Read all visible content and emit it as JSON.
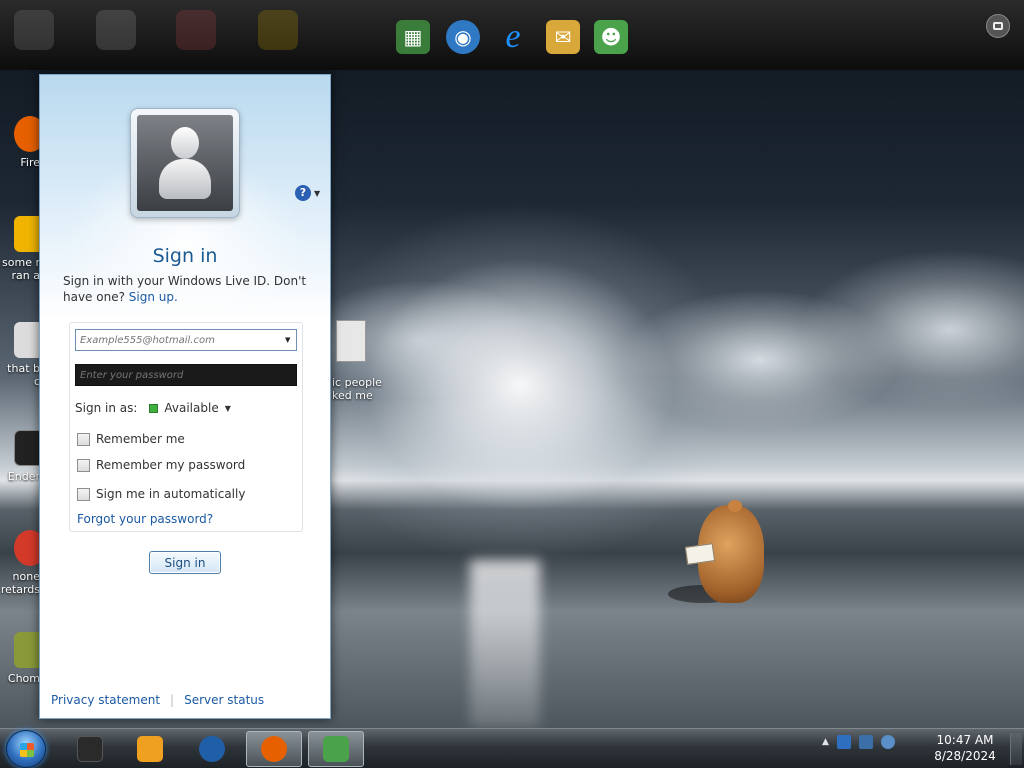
{
  "desktop": {
    "left_icons": [
      {
        "label_line1": "Fire",
        "label_line2": "",
        "color": "#e66000",
        "name": "firefox-desktop-icon"
      },
      {
        "label_line1": "some r",
        "label_line2": "ran a",
        "color": "#f0b400",
        "name": "d-desktop-icon"
      },
      {
        "label_line1": "that b",
        "label_line2": "c",
        "color": "#dcdcdc",
        "name": "briefcase-desktop-icon"
      },
      {
        "label_line1": "Ender",
        "label_line2": "",
        "color": "#222222",
        "name": "ender-desktop-icon"
      },
      {
        "label_line1": "none",
        "label_line2": "retards",
        "color": "#d33a2a",
        "name": "none-desktop-icon"
      },
      {
        "label_line1": "Chom",
        "label_line2": "",
        "color": "#8a9a3a",
        "name": "chom-desktop-icon"
      }
    ],
    "people_icon": {
      "line1": "ic people",
      "line2": "ked me"
    }
  },
  "top_dock": {
    "items": [
      {
        "name": "minecraft-icon",
        "glyph": "▦",
        "color": "#3a7d3a"
      },
      {
        "name": "globe-download-icon",
        "glyph": "◉",
        "color": "#2f78c4"
      },
      {
        "name": "internet-explorer-icon",
        "glyph": "e",
        "color": "#1e90ff"
      },
      {
        "name": "mail-icon",
        "glyph": "✉",
        "color": "#d8a93a"
      },
      {
        "name": "messenger-buddy-icon",
        "glyph": "☻",
        "color": "#4aa34a"
      }
    ]
  },
  "messenger": {
    "help_icon_glyph": "?",
    "title": "Sign in",
    "description": "Sign in with your Windows Live ID. Don't have one?",
    "signup_link": "Sign up.",
    "email_placeholder": "Example555@hotmail.com",
    "password_placeholder": "Enter your password",
    "status_label": "Sign in as:",
    "status_value": "Available",
    "status_color": "#3fb03f",
    "remember_me": "Remember me",
    "remember_password": "Remember my password",
    "sign_in_auto": "Sign me in automatically",
    "forgot_password": "Forgot your password?",
    "sign_in_button": "Sign in",
    "privacy_statement": "Privacy statement",
    "server_status": "Server status"
  },
  "taskbar": {
    "pinned": [
      {
        "name": "task-app-black",
        "color": "#2a2a2a"
      },
      {
        "name": "task-media-player",
        "color": "#f0a020"
      },
      {
        "name": "task-network-globe",
        "color": "#1f5fa8"
      },
      {
        "name": "task-firefox",
        "color": "#e66000"
      },
      {
        "name": "task-messenger",
        "color": "#4aa34a"
      }
    ],
    "tray": [
      {
        "name": "tray-up-arrow-icon",
        "color": "#cfd4d8"
      },
      {
        "name": "tray-device-icon",
        "color": "#2f6fbf"
      },
      {
        "name": "tray-monitor-icon",
        "color": "#3a6fa8"
      },
      {
        "name": "tray-network-icon",
        "color": "#5a8fc8"
      }
    ],
    "time": "10:47 AM",
    "date": "8/28/2024"
  }
}
